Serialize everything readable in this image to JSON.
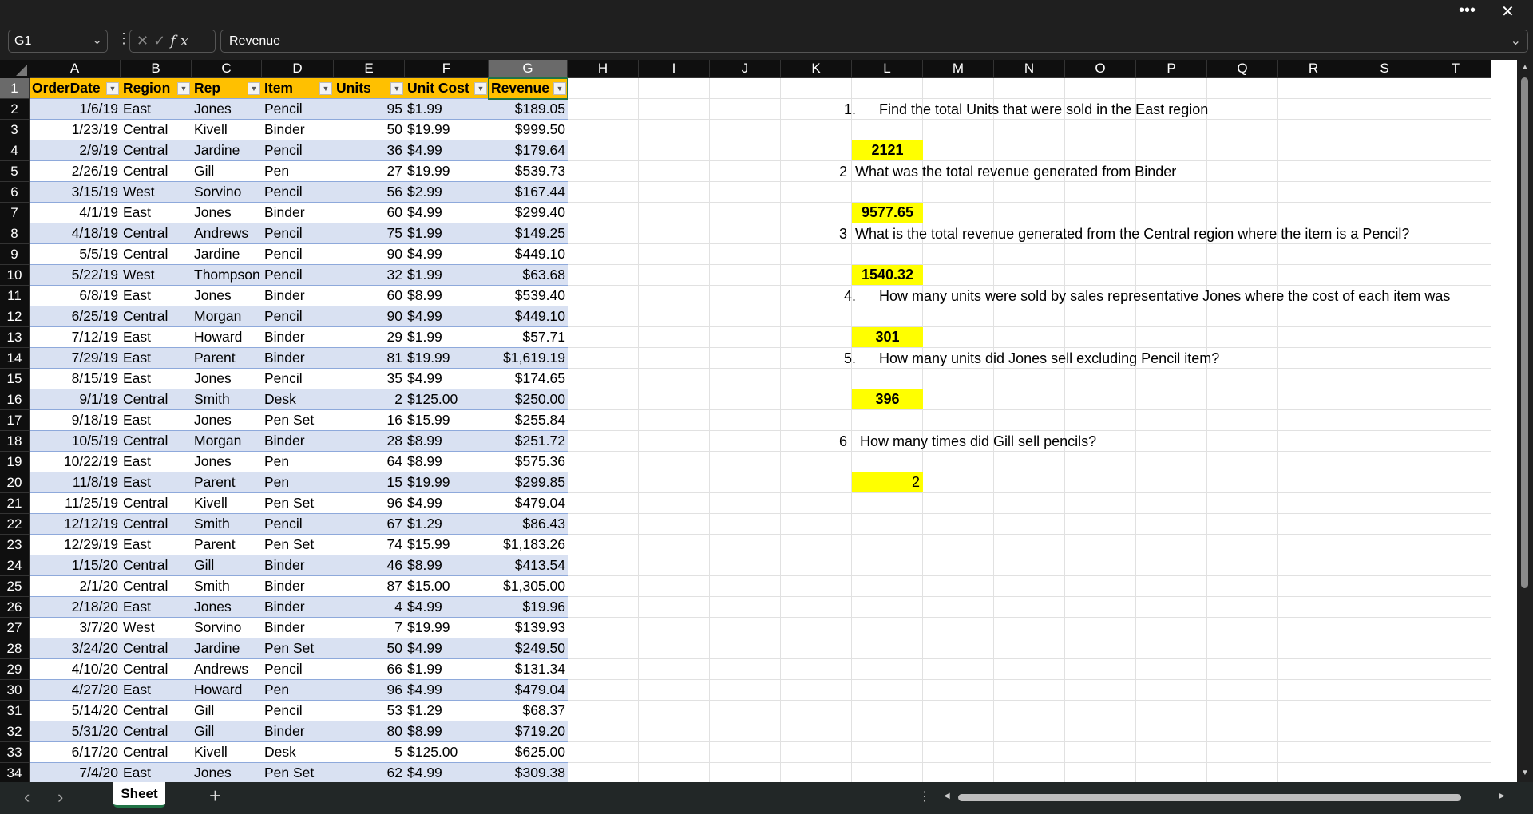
{
  "window": {
    "more_label": "•••",
    "close_label": "✕"
  },
  "formula_bar": {
    "name_box": "G1",
    "formula": "Revenue",
    "cancel": "✕",
    "enter": "✓",
    "fx": "fx"
  },
  "columns": [
    "A",
    "B",
    "C",
    "D",
    "E",
    "F",
    "G",
    "H",
    "I",
    "J",
    "K",
    "L",
    "M",
    "N",
    "O",
    "P",
    "Q",
    "R",
    "S",
    "T"
  ],
  "selected_column": "G",
  "selected_row": 1,
  "table": {
    "headers": [
      "OrderDate",
      "Region",
      "Rep",
      "Item",
      "Units",
      "Unit Cost",
      "Revenue"
    ],
    "rows": [
      [
        "1/6/19",
        "East",
        "Jones",
        "Pencil",
        "95",
        "$1.99",
        "$189.05"
      ],
      [
        "1/23/19",
        "Central",
        "Kivell",
        "Binder",
        "50",
        "$19.99",
        "$999.50"
      ],
      [
        "2/9/19",
        "Central",
        "Jardine",
        "Pencil",
        "36",
        "$4.99",
        "$179.64"
      ],
      [
        "2/26/19",
        "Central",
        "Gill",
        "Pen",
        "27",
        "$19.99",
        "$539.73"
      ],
      [
        "3/15/19",
        "West",
        "Sorvino",
        "Pencil",
        "56",
        "$2.99",
        "$167.44"
      ],
      [
        "4/1/19",
        "East",
        "Jones",
        "Binder",
        "60",
        "$4.99",
        "$299.40"
      ],
      [
        "4/18/19",
        "Central",
        "Andrews",
        "Pencil",
        "75",
        "$1.99",
        "$149.25"
      ],
      [
        "5/5/19",
        "Central",
        "Jardine",
        "Pencil",
        "90",
        "$4.99",
        "$449.10"
      ],
      [
        "5/22/19",
        "West",
        "Thompson",
        "Pencil",
        "32",
        "$1.99",
        "$63.68"
      ],
      [
        "6/8/19",
        "East",
        "Jones",
        "Binder",
        "60",
        "$8.99",
        "$539.40"
      ],
      [
        "6/25/19",
        "Central",
        "Morgan",
        "Pencil",
        "90",
        "$4.99",
        "$449.10"
      ],
      [
        "7/12/19",
        "East",
        "Howard",
        "Binder",
        "29",
        "$1.99",
        "$57.71"
      ],
      [
        "7/29/19",
        "East",
        "Parent",
        "Binder",
        "81",
        "$19.99",
        "$1,619.19"
      ],
      [
        "8/15/19",
        "East",
        "Jones",
        "Pencil",
        "35",
        "$4.99",
        "$174.65"
      ],
      [
        "9/1/19",
        "Central",
        "Smith",
        "Desk",
        "2",
        "$125.00",
        "$250.00"
      ],
      [
        "9/18/19",
        "East",
        "Jones",
        "Pen Set",
        "16",
        "$15.99",
        "$255.84"
      ],
      [
        "10/5/19",
        "Central",
        "Morgan",
        "Binder",
        "28",
        "$8.99",
        "$251.72"
      ],
      [
        "10/22/19",
        "East",
        "Jones",
        "Pen",
        "64",
        "$8.99",
        "$575.36"
      ],
      [
        "11/8/19",
        "East",
        "Parent",
        "Pen",
        "15",
        "$19.99",
        "$299.85"
      ],
      [
        "11/25/19",
        "Central",
        "Kivell",
        "Pen Set",
        "96",
        "$4.99",
        "$479.04"
      ],
      [
        "12/12/19",
        "Central",
        "Smith",
        "Pencil",
        "67",
        "$1.29",
        "$86.43"
      ],
      [
        "12/29/19",
        "East",
        "Parent",
        "Pen Set",
        "74",
        "$15.99",
        "$1,183.26"
      ],
      [
        "1/15/20",
        "Central",
        "Gill",
        "Binder",
        "46",
        "$8.99",
        "$413.54"
      ],
      [
        "2/1/20",
        "Central",
        "Smith",
        "Binder",
        "87",
        "$15.00",
        "$1,305.00"
      ],
      [
        "2/18/20",
        "East",
        "Jones",
        "Binder",
        "4",
        "$4.99",
        "$19.96"
      ],
      [
        "3/7/20",
        "West",
        "Sorvino",
        "Binder",
        "7",
        "$19.99",
        "$139.93"
      ],
      [
        "3/24/20",
        "Central",
        "Jardine",
        "Pen Set",
        "50",
        "$4.99",
        "$249.50"
      ],
      [
        "4/10/20",
        "Central",
        "Andrews",
        "Pencil",
        "66",
        "$1.99",
        "$131.34"
      ],
      [
        "4/27/20",
        "East",
        "Howard",
        "Pen",
        "96",
        "$4.99",
        "$479.04"
      ],
      [
        "5/14/20",
        "Central",
        "Gill",
        "Pencil",
        "53",
        "$1.29",
        "$68.37"
      ],
      [
        "5/31/20",
        "Central",
        "Gill",
        "Binder",
        "80",
        "$8.99",
        "$719.20"
      ],
      [
        "6/17/20",
        "Central",
        "Kivell",
        "Desk",
        "5",
        "$125.00",
        "$625.00"
      ],
      [
        "7/4/20",
        "East",
        "Jones",
        "Pen Set",
        "62",
        "$4.99",
        "$309.38"
      ]
    ]
  },
  "questions": [
    {
      "num": "1.",
      "text": "Find the total Units that were sold in the East region",
      "answer": "2121",
      "q_row": 2,
      "a_row": 4
    },
    {
      "num": "2",
      "text": "What was the total revenue generated from Binder",
      "answer": "9577.65",
      "q_row": 5,
      "a_row": 7
    },
    {
      "num": "3",
      "text": "What is the total revenue generated from the Central region where the item is a Pencil?",
      "answer": "1540.32",
      "q_row": 8,
      "a_row": 10
    },
    {
      "num": "4.",
      "text": "How many units were sold by sales representative Jones where the cost of each item was",
      "answer": "301",
      "q_row": 11,
      "a_row": 13
    },
    {
      "num": "5.",
      "text": "How many units did Jones sell excluding Pencil item?",
      "answer": "396",
      "q_row": 14,
      "a_row": 16
    },
    {
      "num": "6",
      "text": "How many times did Gill sell pencils?",
      "answer": "2",
      "q_row": 18,
      "a_row": 20
    }
  ],
  "colors": {
    "header_fill": "#ffc000",
    "band_fill": "#d9e1f2",
    "answer_fill": "#ffff00",
    "selection": "#217346"
  },
  "sheet_tabs": {
    "active": "Sheet",
    "add": "+",
    "prev": "‹",
    "next": "›"
  }
}
